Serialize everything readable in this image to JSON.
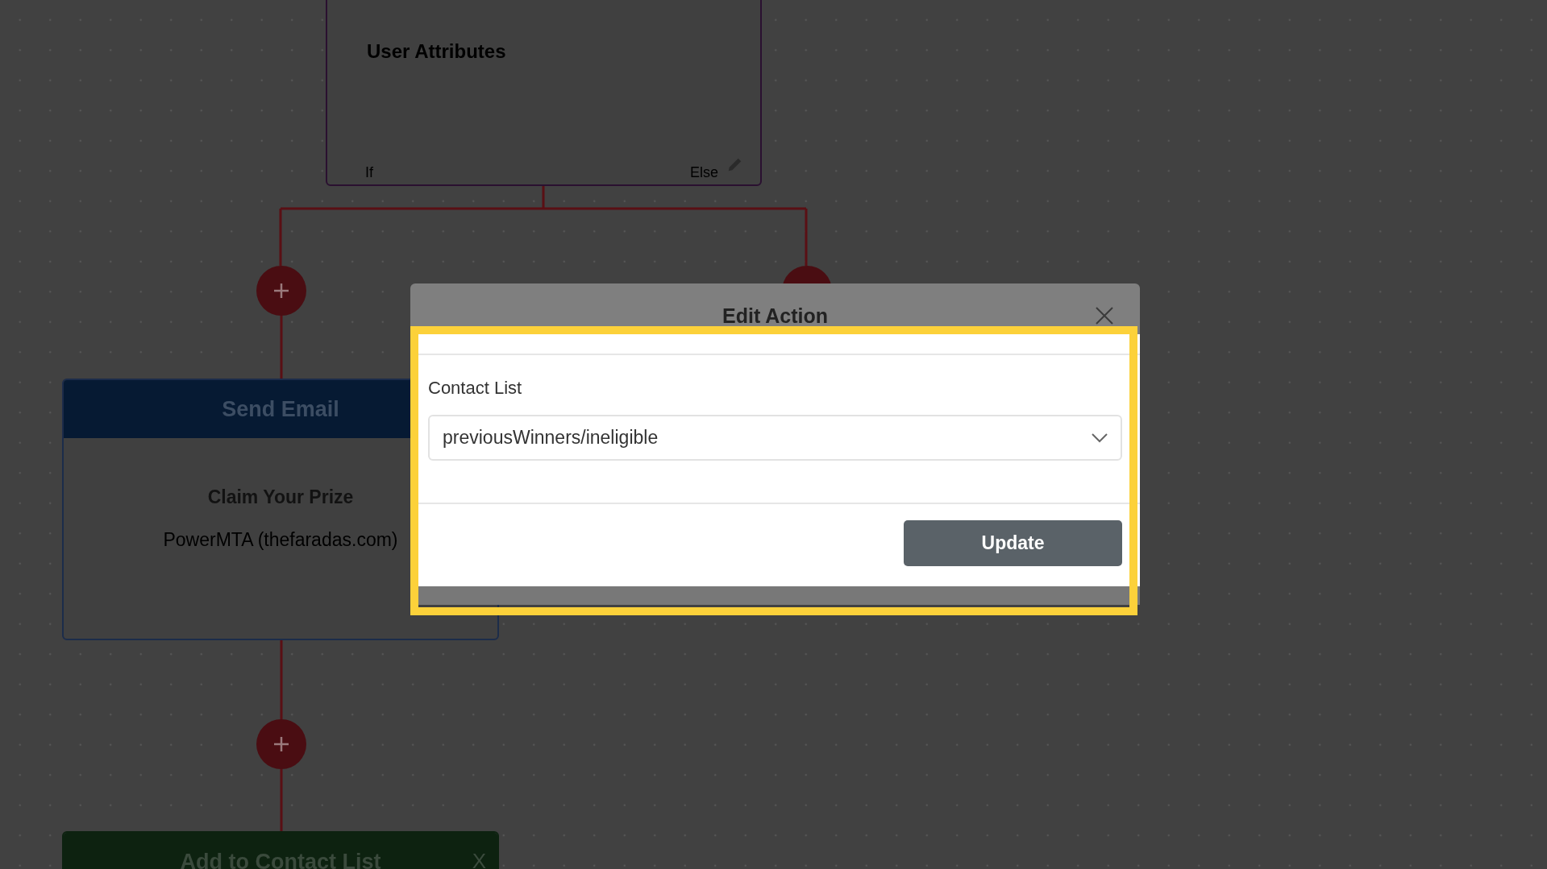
{
  "canvas": {
    "nodes": [
      {
        "kind": "condition",
        "title": "User Attributes",
        "branches": [
          "If",
          "Else"
        ]
      },
      {
        "kind": "email",
        "title": "Send Email",
        "subject": "Claim Your Prize",
        "sender": "PowerMTA (thefaradas.com)"
      },
      {
        "kind": "list",
        "title": "Add to Contact List",
        "close": "X"
      }
    ]
  },
  "modal": {
    "title": "Edit Action",
    "field": {
      "label": "Contact List",
      "value": "previousWinners/ineligible"
    },
    "button": "Update"
  }
}
